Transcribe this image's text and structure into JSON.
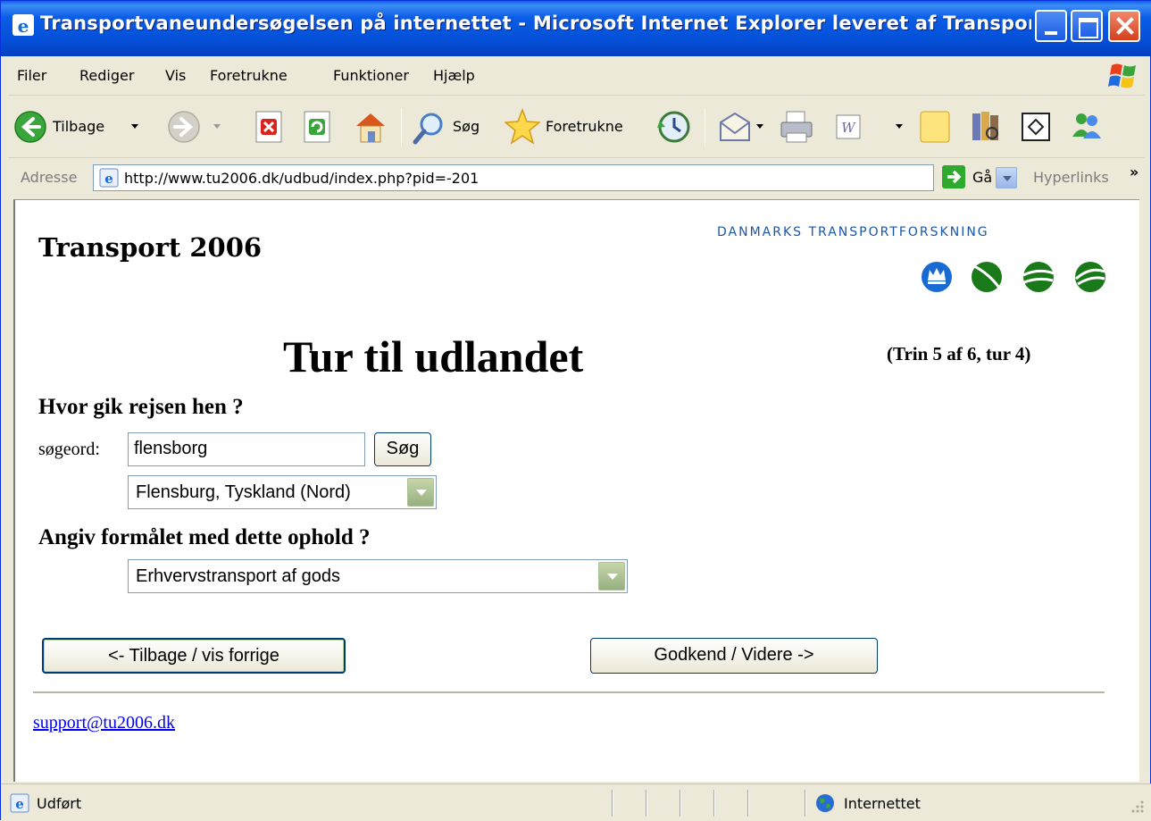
{
  "window": {
    "title": "Transportvaneundersøgelsen på internettet - Microsoft Internet Explorer leveret af  Transport- ..."
  },
  "menu": {
    "items": [
      "Filer",
      "Rediger",
      "Vis",
      "Foretrukne",
      "Funktioner",
      "Hjælp"
    ]
  },
  "toolbar": {
    "back_label": "Tilbage",
    "search_label": "Søg",
    "favorites_label": "Foretrukne"
  },
  "address": {
    "label": "Adresse",
    "url": "http://www.tu2006.dk/udbud/index.php?pid=-201",
    "go_label": "Gå",
    "links_label": "Hyperlinks",
    "chevron": "»"
  },
  "page": {
    "site_title": "Transport 2006",
    "org_name": "Danmarks TransportForskning",
    "heading": "Tur til udlandet",
    "step": "(Trin 5 af 6, tur 4)",
    "question_destination": "Hvor gik rejsen hen ?",
    "search_label": "søgeord:",
    "search_value": "flensborg",
    "search_button": "Søg",
    "destination_selected": "Flensburg, Tyskland (Nord)",
    "question_purpose": "Angiv formålet med dette ophold ?",
    "purpose_selected": "Erhvervstransport af gods",
    "back_button": "<- Tilbage / vis forrige",
    "next_button": "Godkend / Videre ->",
    "support_email": "support@tu2006.dk"
  },
  "status": {
    "text": "Udført",
    "zone": "Internettet"
  },
  "colors": {
    "titlebar": "#0550d8",
    "logo_blue": "#1a56a8",
    "logo_green": "#1a7a1a",
    "link": "#0000ee"
  }
}
